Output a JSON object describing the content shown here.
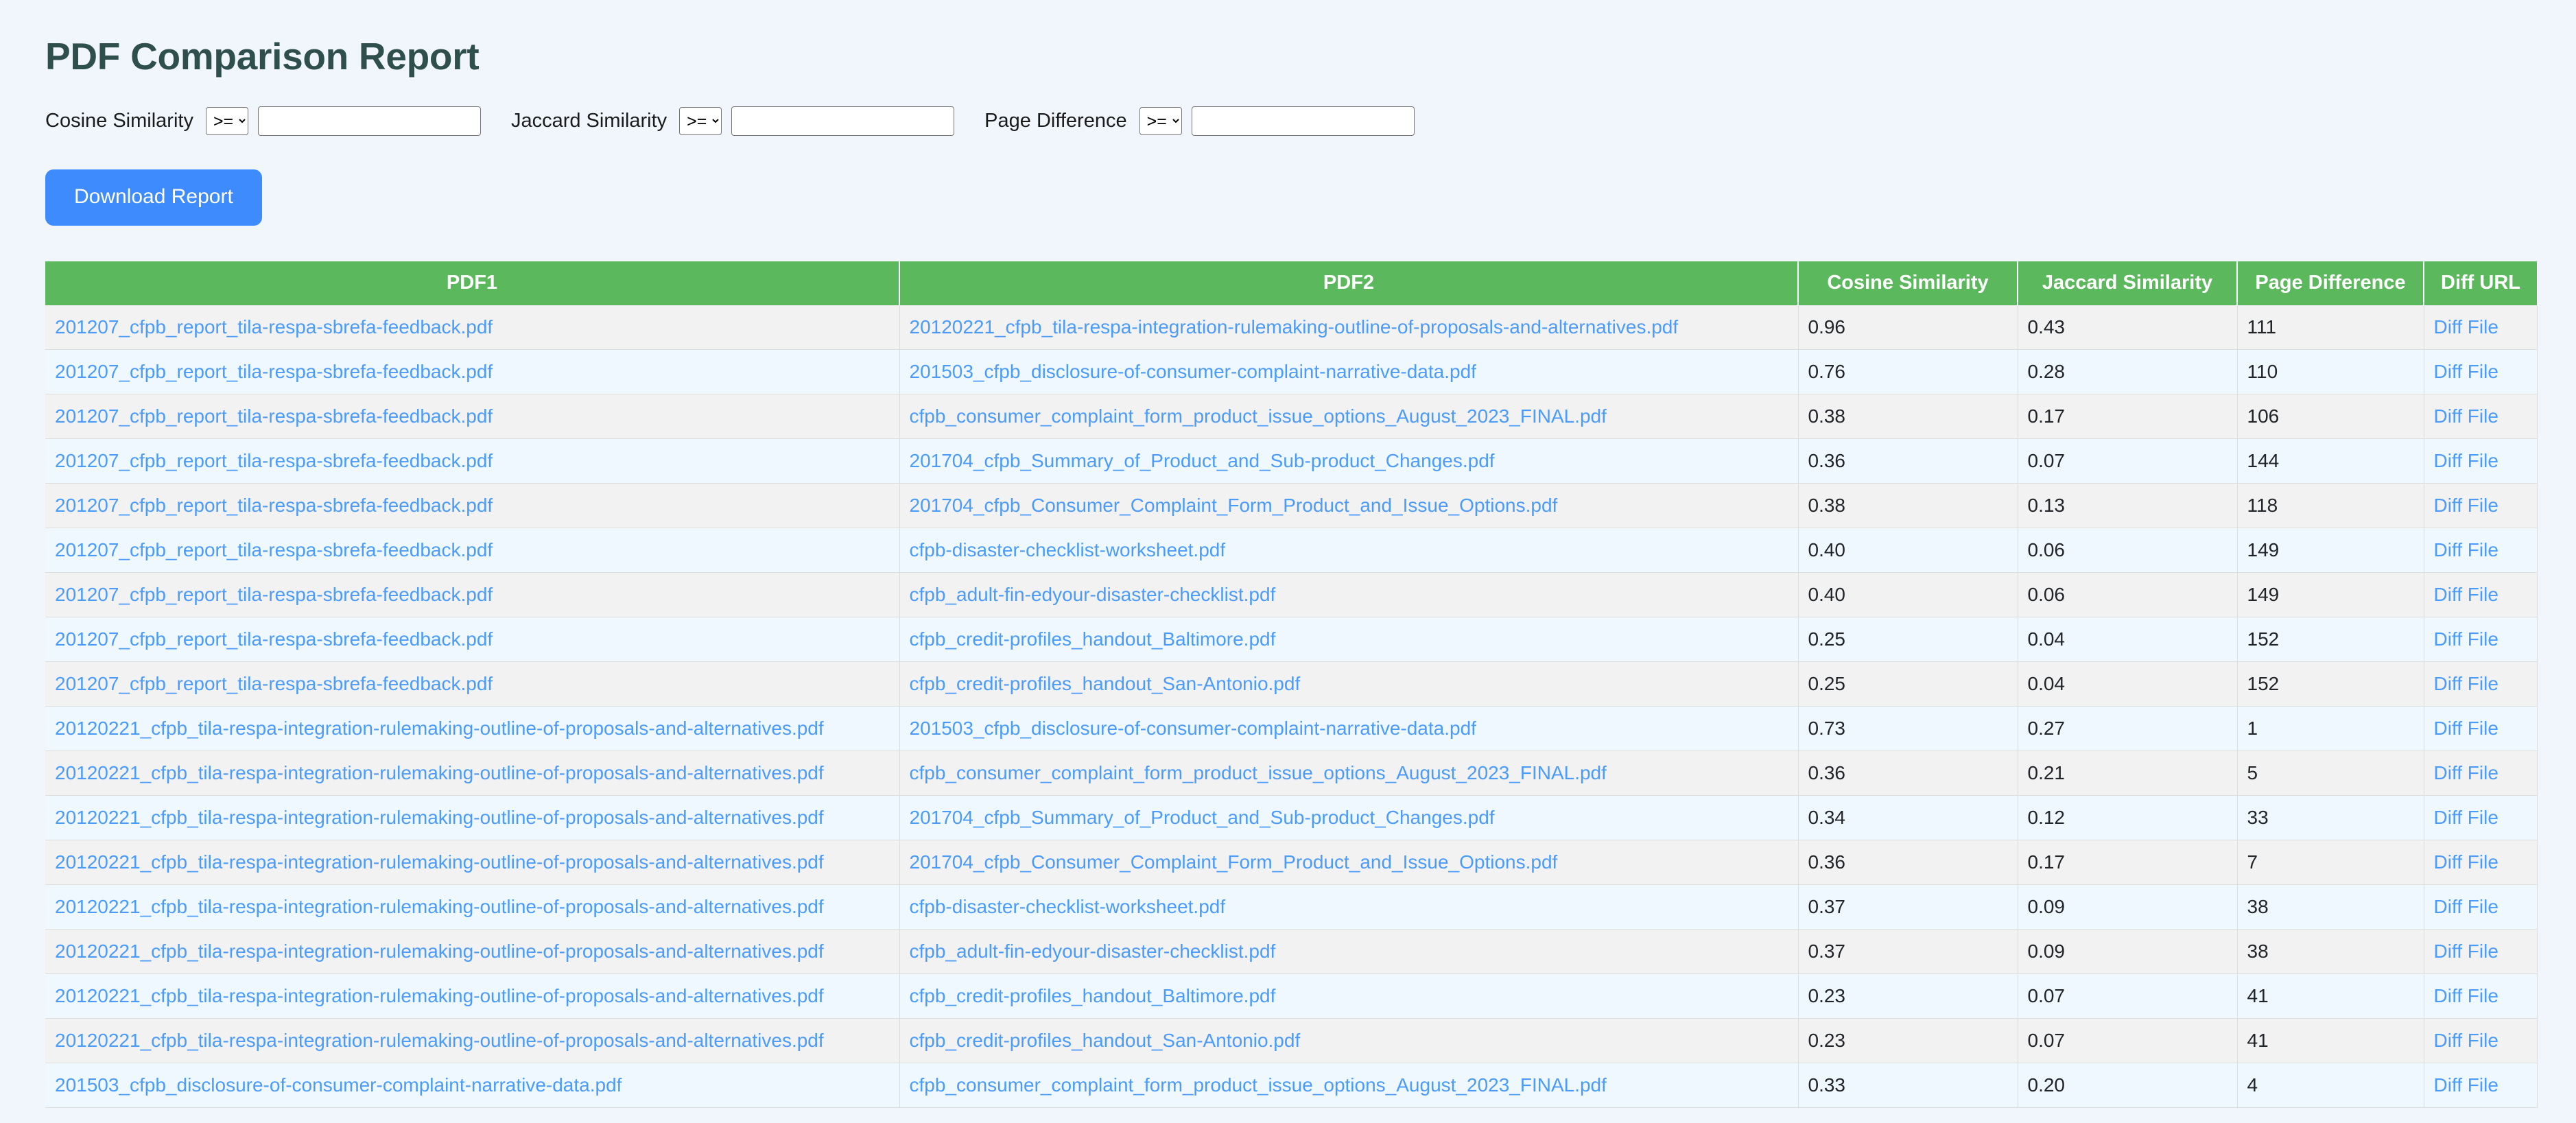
{
  "header": {
    "title": "PDF Comparison Report"
  },
  "filters": [
    {
      "label": "Cosine Similarity",
      "operator": ">=",
      "value": "",
      "placeholder": ""
    },
    {
      "label": "Jaccard Similarity",
      "operator": ">=",
      "value": "",
      "placeholder": ""
    },
    {
      "label": "Page Difference",
      "operator": ">=",
      "value": "",
      "placeholder": ""
    }
  ],
  "operator_options": [
    ">=",
    "<=",
    "=",
    ">",
    "<"
  ],
  "actions": {
    "download_label": "Download Report",
    "download_color": "#3d8bfd"
  },
  "table": {
    "header_color": "#5cb85c",
    "link_color": "#4b9bfa",
    "row_odd_color": "#f2f2f2",
    "row_even_color": "#f0f8ff",
    "columns": [
      "PDF1",
      "PDF2",
      "Cosine Similarity",
      "Jaccard Similarity",
      "Page Difference",
      "Diff URL"
    ],
    "diff_link_label": "Diff File",
    "rows": [
      {
        "pdf1": "201207_cfpb_report_tila-respa-sbrefa-feedback.pdf",
        "pdf2": "20120221_cfpb_tila-respa-integration-rulemaking-outline-of-proposals-and-alternatives.pdf",
        "cosine": "0.96",
        "jaccard": "0.43",
        "page_diff": "111",
        "diff": "Diff File"
      },
      {
        "pdf1": "201207_cfpb_report_tila-respa-sbrefa-feedback.pdf",
        "pdf2": "201503_cfpb_disclosure-of-consumer-complaint-narrative-data.pdf",
        "cosine": "0.76",
        "jaccard": "0.28",
        "page_diff": "110",
        "diff": "Diff File"
      },
      {
        "pdf1": "201207_cfpb_report_tila-respa-sbrefa-feedback.pdf",
        "pdf2": "cfpb_consumer_complaint_form_product_issue_options_August_2023_FINAL.pdf",
        "cosine": "0.38",
        "jaccard": "0.17",
        "page_diff": "106",
        "diff": "Diff File"
      },
      {
        "pdf1": "201207_cfpb_report_tila-respa-sbrefa-feedback.pdf",
        "pdf2": "201704_cfpb_Summary_of_Product_and_Sub-product_Changes.pdf",
        "cosine": "0.36",
        "jaccard": "0.07",
        "page_diff": "144",
        "diff": "Diff File"
      },
      {
        "pdf1": "201207_cfpb_report_tila-respa-sbrefa-feedback.pdf",
        "pdf2": "201704_cfpb_Consumer_Complaint_Form_Product_and_Issue_Options.pdf",
        "cosine": "0.38",
        "jaccard": "0.13",
        "page_diff": "118",
        "diff": "Diff File"
      },
      {
        "pdf1": "201207_cfpb_report_tila-respa-sbrefa-feedback.pdf",
        "pdf2": "cfpb-disaster-checklist-worksheet.pdf",
        "cosine": "0.40",
        "jaccard": "0.06",
        "page_diff": "149",
        "diff": "Diff File"
      },
      {
        "pdf1": "201207_cfpb_report_tila-respa-sbrefa-feedback.pdf",
        "pdf2": "cfpb_adult-fin-edyour-disaster-checklist.pdf",
        "cosine": "0.40",
        "jaccard": "0.06",
        "page_diff": "149",
        "diff": "Diff File"
      },
      {
        "pdf1": "201207_cfpb_report_tila-respa-sbrefa-feedback.pdf",
        "pdf2": "cfpb_credit-profiles_handout_Baltimore.pdf",
        "cosine": "0.25",
        "jaccard": "0.04",
        "page_diff": "152",
        "diff": "Diff File"
      },
      {
        "pdf1": "201207_cfpb_report_tila-respa-sbrefa-feedback.pdf",
        "pdf2": "cfpb_credit-profiles_handout_San-Antonio.pdf",
        "cosine": "0.25",
        "jaccard": "0.04",
        "page_diff": "152",
        "diff": "Diff File"
      },
      {
        "pdf1": "20120221_cfpb_tila-respa-integration-rulemaking-outline-of-proposals-and-alternatives.pdf",
        "pdf2": "201503_cfpb_disclosure-of-consumer-complaint-narrative-data.pdf",
        "cosine": "0.73",
        "jaccard": "0.27",
        "page_diff": "1",
        "diff": "Diff File"
      },
      {
        "pdf1": "20120221_cfpb_tila-respa-integration-rulemaking-outline-of-proposals-and-alternatives.pdf",
        "pdf2": "cfpb_consumer_complaint_form_product_issue_options_August_2023_FINAL.pdf",
        "cosine": "0.36",
        "jaccard": "0.21",
        "page_diff": "5",
        "diff": "Diff File"
      },
      {
        "pdf1": "20120221_cfpb_tila-respa-integration-rulemaking-outline-of-proposals-and-alternatives.pdf",
        "pdf2": "201704_cfpb_Summary_of_Product_and_Sub-product_Changes.pdf",
        "cosine": "0.34",
        "jaccard": "0.12",
        "page_diff": "33",
        "diff": "Diff File"
      },
      {
        "pdf1": "20120221_cfpb_tila-respa-integration-rulemaking-outline-of-proposals-and-alternatives.pdf",
        "pdf2": "201704_cfpb_Consumer_Complaint_Form_Product_and_Issue_Options.pdf",
        "cosine": "0.36",
        "jaccard": "0.17",
        "page_diff": "7",
        "diff": "Diff File"
      },
      {
        "pdf1": "20120221_cfpb_tila-respa-integration-rulemaking-outline-of-proposals-and-alternatives.pdf",
        "pdf2": "cfpb-disaster-checklist-worksheet.pdf",
        "cosine": "0.37",
        "jaccard": "0.09",
        "page_diff": "38",
        "diff": "Diff File"
      },
      {
        "pdf1": "20120221_cfpb_tila-respa-integration-rulemaking-outline-of-proposals-and-alternatives.pdf",
        "pdf2": "cfpb_adult-fin-edyour-disaster-checklist.pdf",
        "cosine": "0.37",
        "jaccard": "0.09",
        "page_diff": "38",
        "diff": "Diff File"
      },
      {
        "pdf1": "20120221_cfpb_tila-respa-integration-rulemaking-outline-of-proposals-and-alternatives.pdf",
        "pdf2": "cfpb_credit-profiles_handout_Baltimore.pdf",
        "cosine": "0.23",
        "jaccard": "0.07",
        "page_diff": "41",
        "diff": "Diff File"
      },
      {
        "pdf1": "20120221_cfpb_tila-respa-integration-rulemaking-outline-of-proposals-and-alternatives.pdf",
        "pdf2": "cfpb_credit-profiles_handout_San-Antonio.pdf",
        "cosine": "0.23",
        "jaccard": "0.07",
        "page_diff": "41",
        "diff": "Diff File"
      },
      {
        "pdf1": "201503_cfpb_disclosure-of-consumer-complaint-narrative-data.pdf",
        "pdf2": "cfpb_consumer_complaint_form_product_issue_options_August_2023_FINAL.pdf",
        "cosine": "0.33",
        "jaccard": "0.20",
        "page_diff": "4",
        "diff": "Diff File"
      }
    ]
  }
}
